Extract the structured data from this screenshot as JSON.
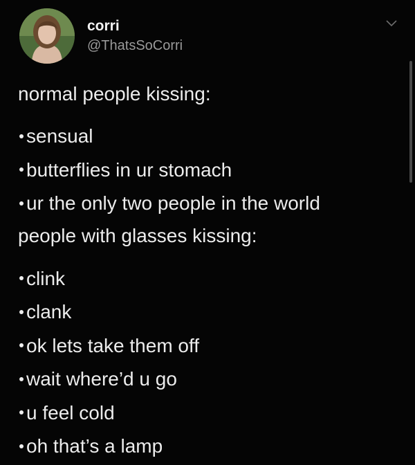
{
  "user": {
    "display_name": "corri",
    "handle": "@ThatsSoCorri",
    "avatar_icon": "profile-avatar"
  },
  "menu_icon": "chevron-down-icon",
  "tweet": {
    "section1": {
      "heading": "normal people kissing:",
      "items": [
        "sensual",
        "butterflies in ur stomach",
        "ur the only two people in the world"
      ]
    },
    "section2": {
      "heading": "people with glasses kissing:",
      "items": [
        "clink",
        "clank",
        "ok lets take them off",
        "wait where’d u go",
        "u feel cold",
        "oh that’s a lamp"
      ]
    }
  },
  "colors": {
    "background": "#050505",
    "text": "#ececec",
    "handle": "#9a9a9a"
  }
}
